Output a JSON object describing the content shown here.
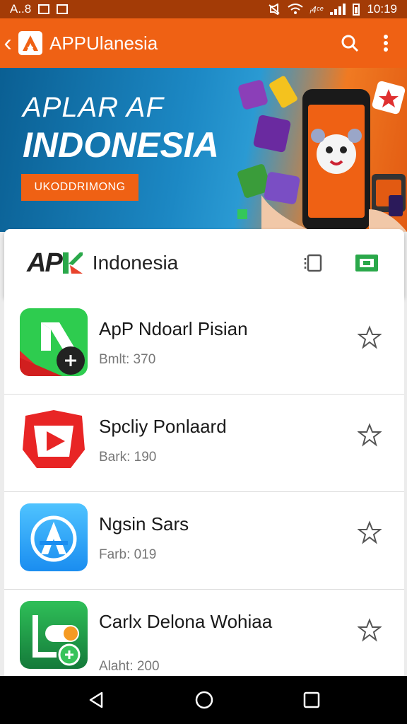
{
  "status_bar": {
    "left_text": "A..8",
    "network_text": "ᵢ4ᶜᵉ",
    "time": "10:19"
  },
  "app_bar": {
    "title": "APPUlanesia",
    "icons": [
      "back-icon",
      "app-logo",
      "search-icon",
      "more-vert-icon"
    ]
  },
  "banner": {
    "line1": "APLAR AF",
    "line2": "INDONESIA",
    "button_label": "UKODDRIMONG"
  },
  "header_card": {
    "brand": "AP",
    "title": "Indonesia",
    "icons": [
      "layers-icon",
      "grid-icon"
    ]
  },
  "apps": [
    {
      "name": "ApP Ndoarl Pisian",
      "meta": "Bmlt: 370",
      "icon": "green-arrow-icon"
    },
    {
      "name": "Spcliy Ponlaard",
      "meta": "Bark: 190",
      "icon": "red-play-icon"
    },
    {
      "name": "Ngsin Sars",
      "meta": "Farb: 019",
      "icon": "blue-a-icon"
    },
    {
      "name": "Carlx Delona Wohiaa",
      "meta": "Alaht: 200",
      "icon": "green-toggle-icon"
    }
  ],
  "colors": {
    "app_bar": "#ef6114",
    "status_bar": "#a33b06",
    "nav_bar": "#000000"
  }
}
